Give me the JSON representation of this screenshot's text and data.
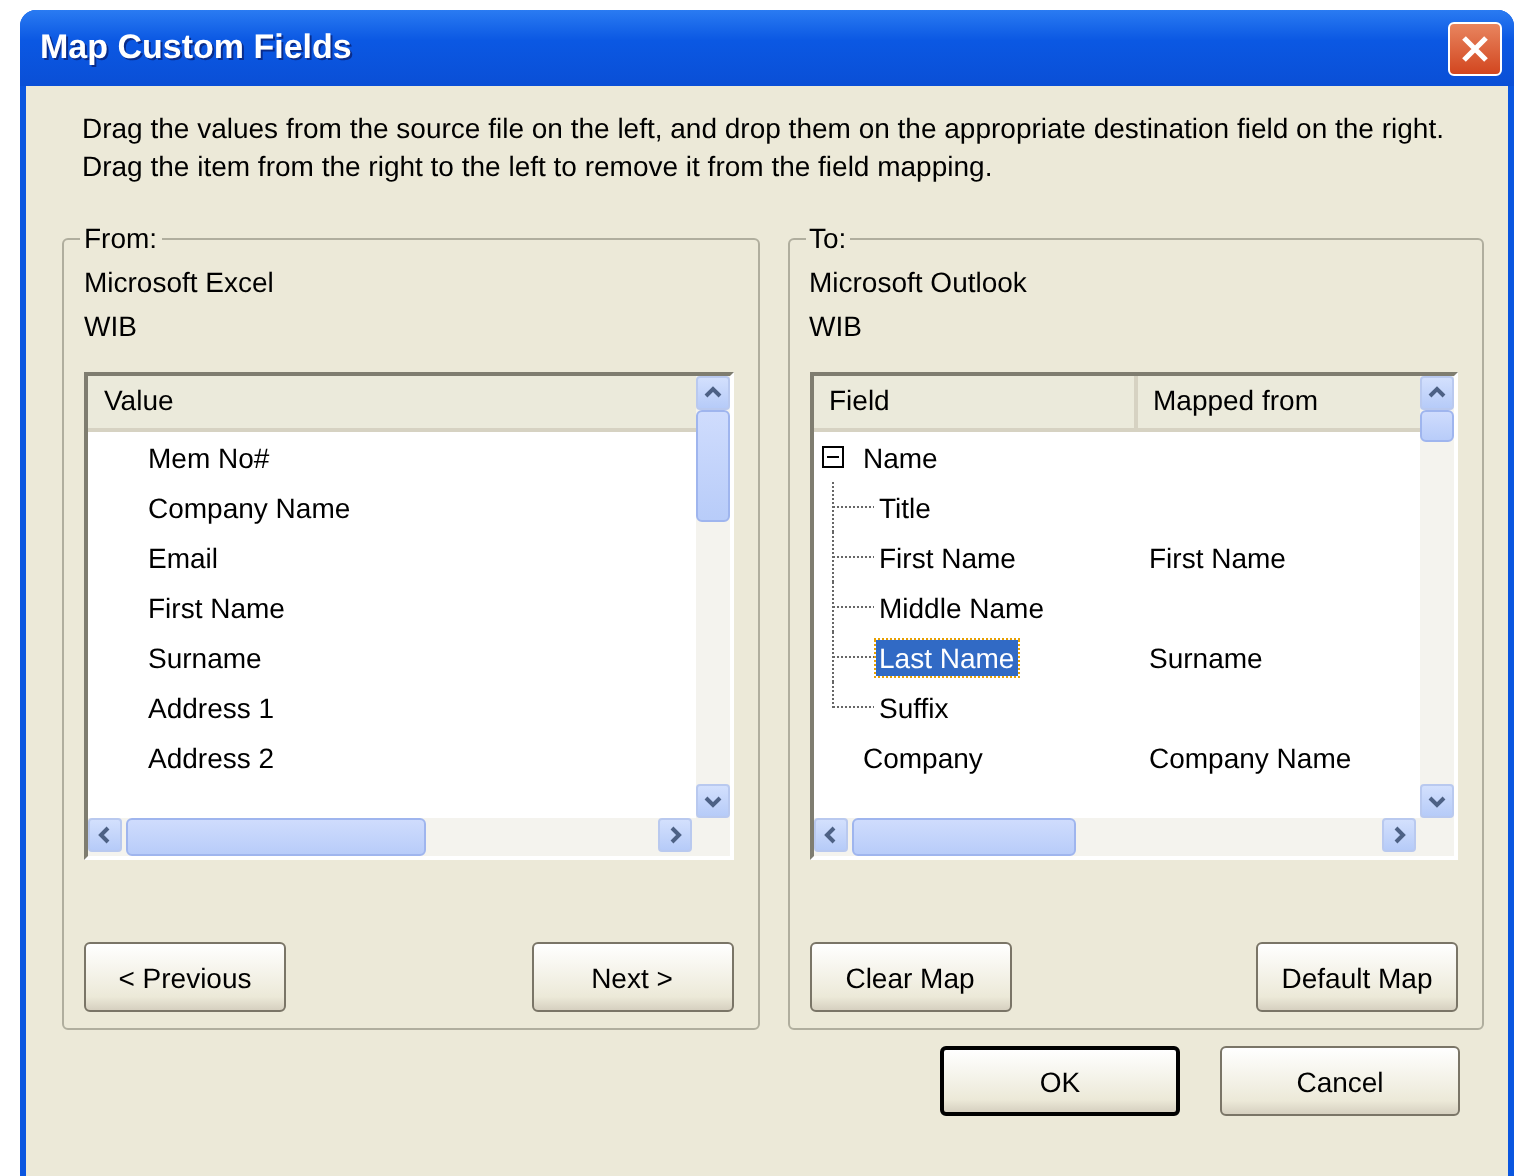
{
  "window": {
    "title": "Map Custom Fields"
  },
  "instructions": "Drag the values from the source file on the left, and drop them on the appropriate destination field on the right.  Drag the item from the right to the left to remove it from the field mapping.",
  "source": {
    "legend": "From:",
    "application": "Microsoft Excel",
    "file": "WIB",
    "column": "Value",
    "items": [
      "Mem No#",
      "Company Name",
      "Email",
      "First Name",
      "Surname",
      "Address 1",
      "Address 2"
    ],
    "buttons": [
      "< Previous",
      "Next >"
    ]
  },
  "destination": {
    "legend": "To:",
    "application": "Microsoft Outlook",
    "file": "WIB",
    "columns": [
      "Field",
      "Mapped from"
    ],
    "fields": [
      {
        "label": "Name",
        "selected": false,
        "expanded": true,
        "children": [
          {
            "label": "Title",
            "selected": false
          },
          {
            "label": "First Name",
            "mapped_from": "First Name",
            "selected": false
          },
          {
            "label": "Middle Name",
            "selected": false
          },
          {
            "label": "Last Name",
            "mapped_from": "Surname",
            "selected": true
          },
          {
            "label": "Suffix",
            "selected": false
          }
        ]
      },
      {
        "label": "Company",
        "mapped_from": "Company Name",
        "selected": false
      }
    ],
    "buttons": [
      "Clear Map",
      "Default Map"
    ]
  },
  "buttons": [
    {
      "label": "OK",
      "default": true
    },
    {
      "label": "Cancel",
      "default": false
    }
  ]
}
